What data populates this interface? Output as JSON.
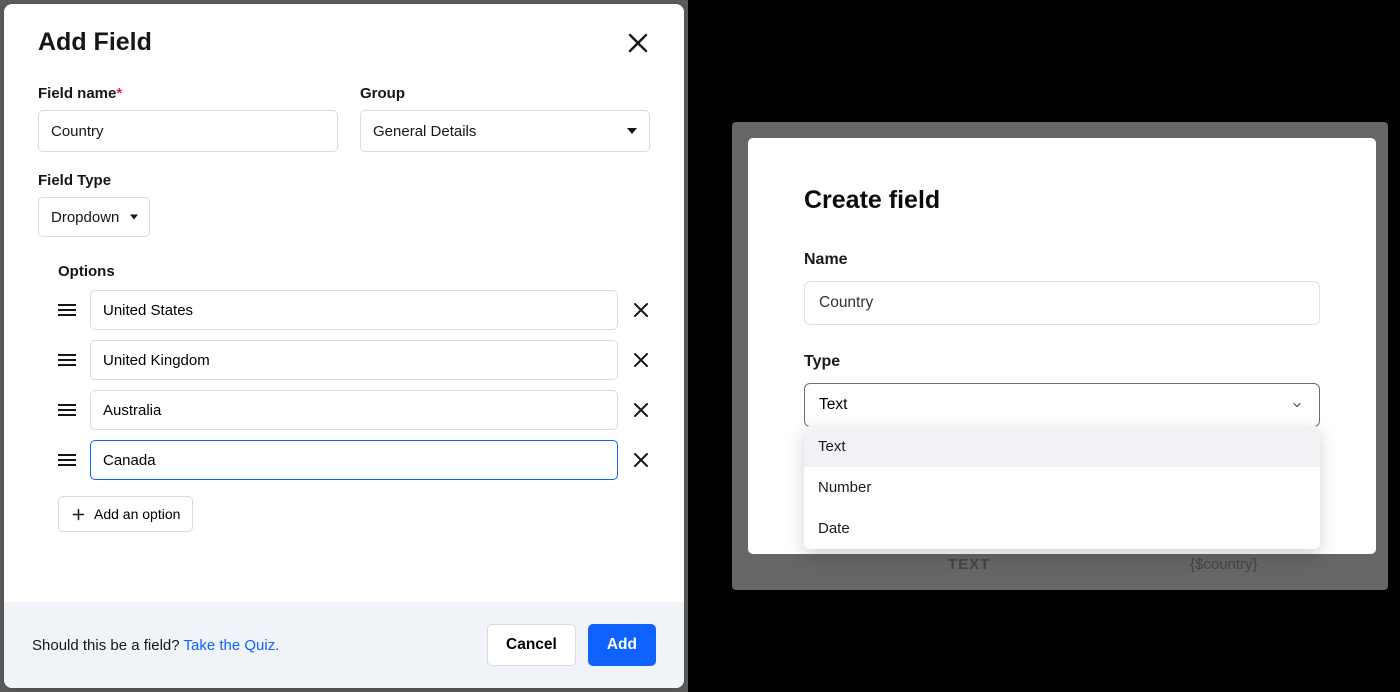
{
  "left": {
    "title": "Add Field",
    "labels": {
      "field_name": "Field name",
      "group": "Group",
      "field_type": "Field Type",
      "options": "Options"
    },
    "field_name_value": "Country",
    "group_value": "General Details",
    "field_type_value": "Dropdown",
    "options": [
      "United States",
      "United Kingdom",
      "Australia",
      "Canada"
    ],
    "add_option_label": "Add an option",
    "footer": {
      "text": "Should this be a field? ",
      "link": "Take the Quiz.",
      "cancel": "Cancel",
      "add": "Add"
    }
  },
  "right": {
    "title": "Create field",
    "labels": {
      "name": "Name",
      "type": "Type"
    },
    "name_value": "Country",
    "type_value": "Text",
    "type_options": [
      "Text",
      "Number",
      "Date"
    ],
    "bg_hint_left": "TEXT",
    "bg_hint_right": "{$country}"
  }
}
